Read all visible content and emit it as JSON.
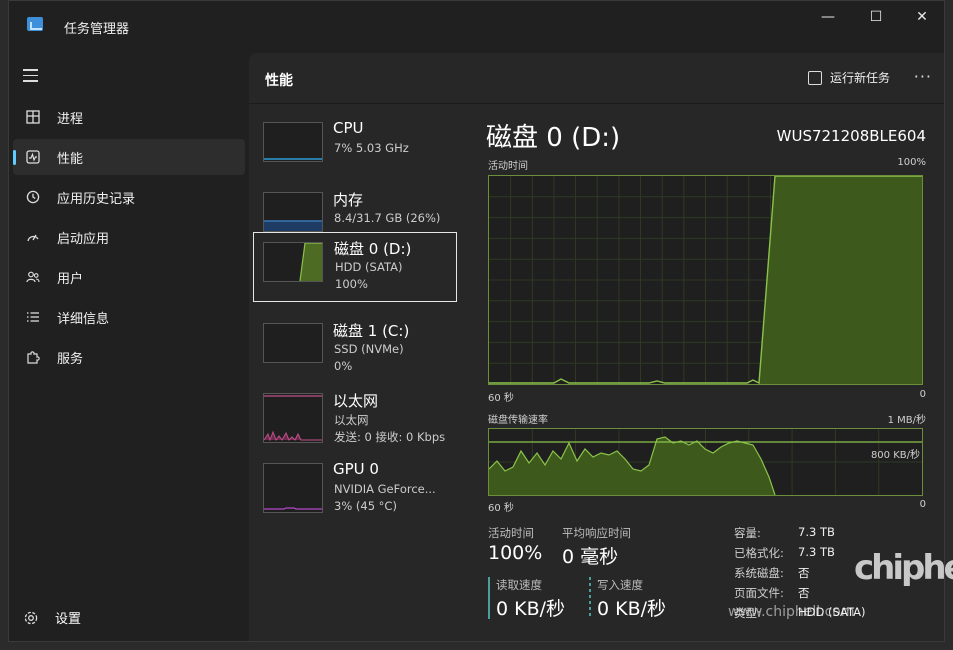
{
  "window": {
    "title": "任务管理器",
    "min_glyph": "—",
    "max_glyph": "☐",
    "close_glyph": "✕"
  },
  "sidebar": {
    "items": [
      {
        "label": "进程",
        "icon": "processes-grid-icon"
      },
      {
        "label": "性能",
        "icon": "performance-chart-icon",
        "active": true
      },
      {
        "label": "应用历史记录",
        "icon": "history-clock-icon"
      },
      {
        "label": "启动应用",
        "icon": "startup-gauge-icon"
      },
      {
        "label": "用户",
        "icon": "users-icon"
      },
      {
        "label": "详细信息",
        "icon": "details-list-icon"
      },
      {
        "label": "服务",
        "icon": "services-puzzle-icon"
      }
    ],
    "settings_label": "设置"
  },
  "header": {
    "title": "性能",
    "run_task_label": "运行新任务",
    "more_label": "···"
  },
  "devices": [
    {
      "name": "CPU",
      "line2": "7% 5.03 GHz",
      "line3": ""
    },
    {
      "name": "内存",
      "line2": "8.4/31.7 GB (26%)",
      "line3": ""
    },
    {
      "name": "磁盘 0 (D:)",
      "line2": "HDD (SATA)",
      "line3": "100%",
      "selected": true
    },
    {
      "name": "磁盘 1 (C:)",
      "line2": "SSD (NVMe)",
      "line3": "0%"
    },
    {
      "name": "以太网",
      "line2": "以太网",
      "line3": "发送: 0 接收: 0 Kbps"
    },
    {
      "name": "GPU 0",
      "line2": "NVIDIA GeForce...",
      "line3": "3% (45 °C)"
    }
  ],
  "detail": {
    "title": "磁盘 0 (D:)",
    "model": "WUS721208BLE604",
    "graph1": {
      "label": "活动时间",
      "max": "100%",
      "left": "60 秒",
      "right": "0"
    },
    "graph2": {
      "label": "磁盘传输速率",
      "max": "1 MB/秒",
      "mark": "800 KB/秒",
      "left": "60 秒",
      "right": "0"
    },
    "stats": {
      "active_label": "活动时间",
      "active_value": "100%",
      "response_label": "平均响应时间",
      "response_value": "0 毫秒",
      "read_label": "读取速度",
      "read_value": "0 KB/秒",
      "write_label": "写入速度",
      "write_value": "0 KB/秒"
    },
    "props": [
      {
        "k": "容量:",
        "v": "7.3 TB"
      },
      {
        "k": "已格式化:",
        "v": "7.3 TB"
      },
      {
        "k": "系统磁盘:",
        "v": "否"
      },
      {
        "k": "页面文件:",
        "v": "否"
      },
      {
        "k": "类型:",
        "v": "HDD (SATA)"
      }
    ]
  },
  "watermark": {
    "url": "www.chiphell.com",
    "logo": "chiphell"
  },
  "colors": {
    "accent": "#60cdff",
    "disk_green": "#8bc34a",
    "disk_fill": "#3d5a1c"
  }
}
